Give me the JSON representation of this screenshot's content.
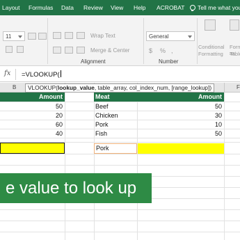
{
  "ribbon_tabs": [
    "Layout",
    "Formulas",
    "Data",
    "Review",
    "View",
    "Help",
    "ACROBAT"
  ],
  "tell_me": "Tell me what you",
  "ribbon": {
    "font_size": "11",
    "wrap_text": "Wrap Text",
    "merge_center": "Merge & Center",
    "number_format": "General",
    "number_symbols": [
      "$",
      "%",
      ","
    ],
    "cond_format_label_1": "Conditional",
    "cond_format_label_2": "Formatting",
    "format_table_label_1": "Format as",
    "format_table_label_2": "Table",
    "alignment_label": "Alignment",
    "number_label": "Number"
  },
  "formula_bar": {
    "fx": "fx",
    "text": "=VLOOKUP("
  },
  "tooltip": {
    "bold_arg": "lookup_value",
    "prefix": "VLOOKUP(",
    "rest": ", table_array, col_index_num, [range_lookup])"
  },
  "column_headers": {
    "b": "B",
    "f": "F"
  },
  "left_table": {
    "header": "Amount",
    "values": [
      "50",
      "20",
      "60",
      "40"
    ]
  },
  "right_table": {
    "meat_header": "Meat",
    "amount_header": "Amount",
    "meats": [
      "Beef",
      "Chicken",
      "Pork",
      "Fish"
    ],
    "amounts": [
      "50",
      "30",
      "10",
      "50"
    ]
  },
  "lookup_cell": "Pork",
  "banner_text": "e value to look up",
  "colors": {
    "excel_green": "#217346",
    "banner_green": "#2e8b45",
    "highlight_yellow": "#ffff00"
  }
}
